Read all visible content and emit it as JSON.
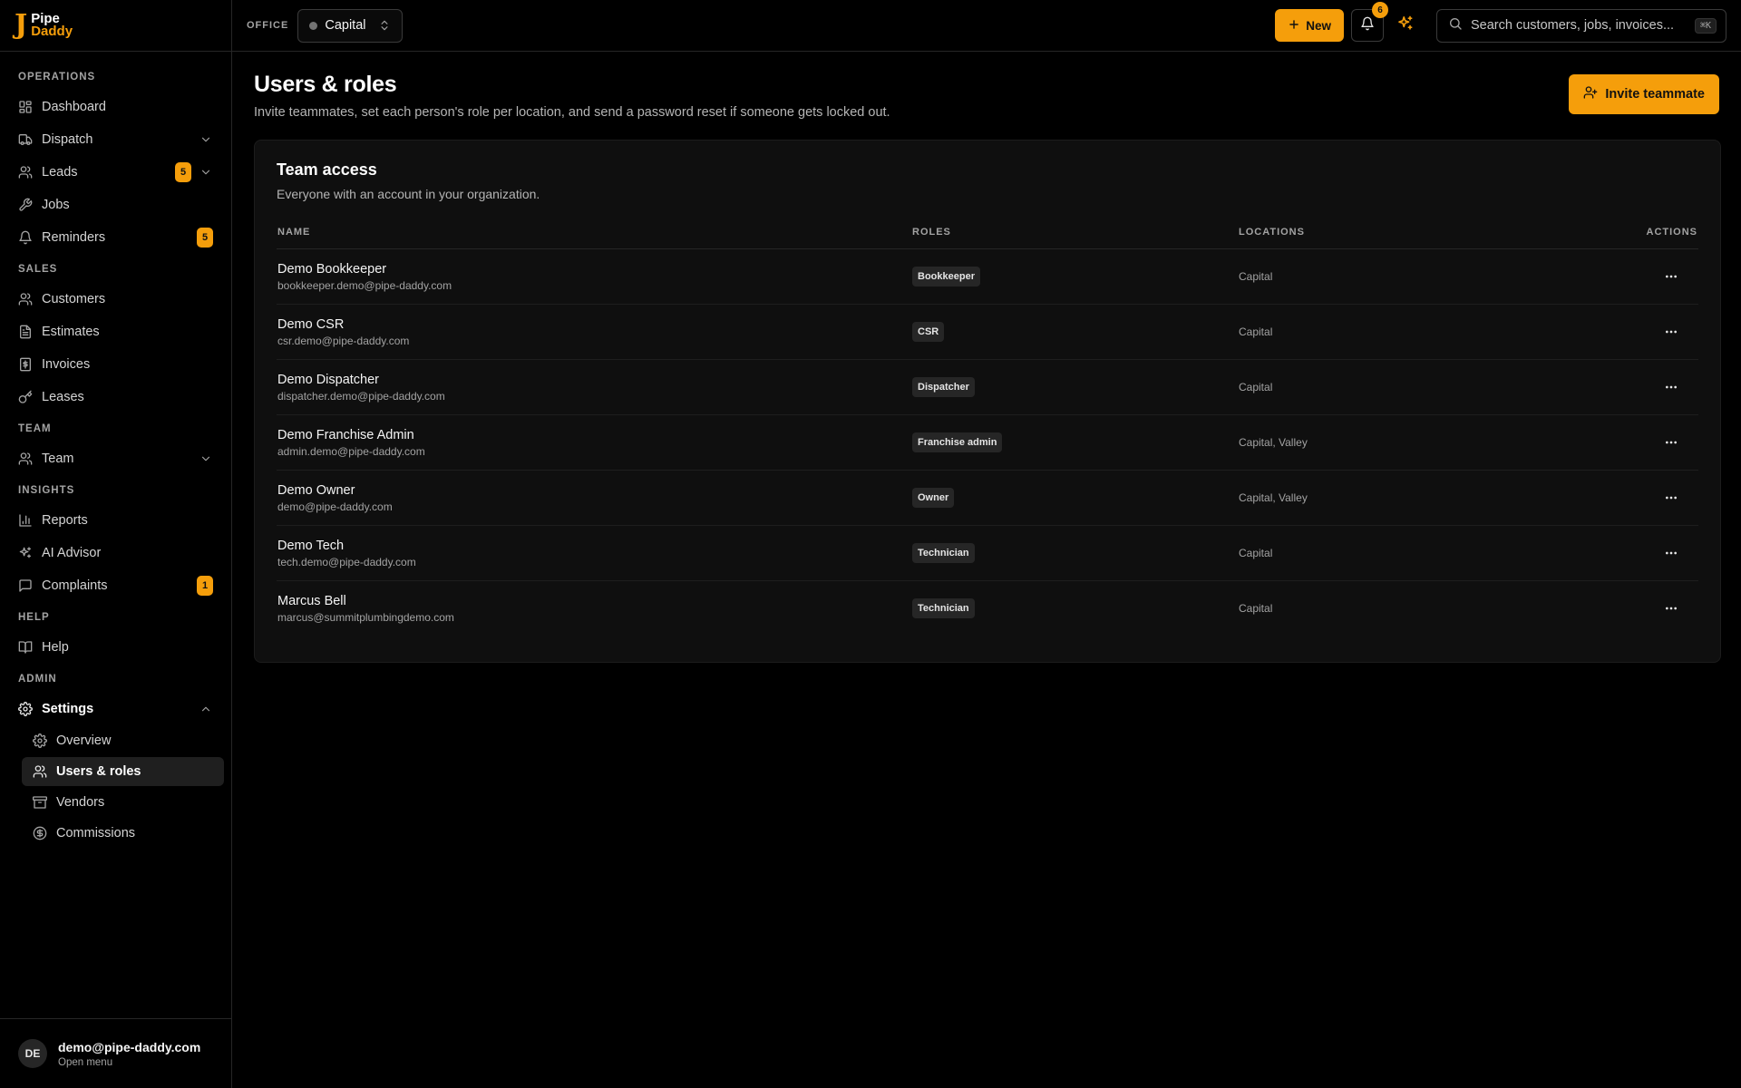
{
  "brand": {
    "mark": "J",
    "line1": "Pipe",
    "line2": "Daddy"
  },
  "sidebar": {
    "sections": [
      {
        "label": "OPERATIONS",
        "items": [
          {
            "label": "Dashboard",
            "icon": "dashboard-icon"
          },
          {
            "label": "Dispatch",
            "icon": "truck-icon",
            "chevron": "down"
          },
          {
            "label": "Leads",
            "icon": "users-icon",
            "badge": "5",
            "chevron": "down"
          },
          {
            "label": "Jobs",
            "icon": "wrench-icon"
          },
          {
            "label": "Reminders",
            "icon": "bell-icon",
            "badge": "5"
          }
        ]
      },
      {
        "label": "SALES",
        "items": [
          {
            "label": "Customers",
            "icon": "users-icon"
          },
          {
            "label": "Estimates",
            "icon": "document-icon"
          },
          {
            "label": "Invoices",
            "icon": "receipt-icon"
          },
          {
            "label": "Leases",
            "icon": "key-icon"
          }
        ]
      },
      {
        "label": "TEAM",
        "items": [
          {
            "label": "Team",
            "icon": "users-icon",
            "chevron": "down"
          }
        ]
      },
      {
        "label": "INSIGHTS",
        "items": [
          {
            "label": "Reports",
            "icon": "bar-chart-icon"
          },
          {
            "label": "AI Advisor",
            "icon": "sparkles-icon"
          },
          {
            "label": "Complaints",
            "icon": "message-icon",
            "badge": "1"
          }
        ]
      },
      {
        "label": "HELP",
        "items": [
          {
            "label": "Help",
            "icon": "book-icon"
          }
        ]
      }
    ],
    "admin": {
      "label": "ADMIN",
      "settings_label": "Settings",
      "sub_items": [
        {
          "label": "Overview",
          "icon": "gear-icon"
        },
        {
          "label": "Users & roles",
          "icon": "users-icon",
          "active": true
        },
        {
          "label": "Vendors",
          "icon": "package-icon"
        },
        {
          "label": "Commissions",
          "icon": "dollar-circle-icon"
        }
      ]
    },
    "user": {
      "initials": "DE",
      "email": "demo@pipe-daddy.com",
      "sub": "Open menu"
    }
  },
  "topbar": {
    "office_label": "OFFICE",
    "office_value": "Capital",
    "new_label": "New",
    "notification_count": "6",
    "search_placeholder": "Search customers, jobs, invoices...",
    "search_shortcut": "⌘K"
  },
  "page": {
    "title": "Users & roles",
    "subtitle": "Invite teammates, set each person's role per location, and send a password reset if someone gets locked out.",
    "invite_label": "Invite teammate"
  },
  "card": {
    "title": "Team access",
    "subtitle": "Everyone with an account in your organization.",
    "columns": [
      "NAME",
      "ROLES",
      "LOCATIONS",
      "ACTIONS"
    ],
    "rows": [
      {
        "name": "Demo Bookkeeper",
        "email": "bookkeeper.demo@pipe-daddy.com",
        "role": "Bookkeeper",
        "locations": "Capital"
      },
      {
        "name": "Demo CSR",
        "email": "csr.demo@pipe-daddy.com",
        "role": "CSR",
        "locations": "Capital"
      },
      {
        "name": "Demo Dispatcher",
        "email": "dispatcher.demo@pipe-daddy.com",
        "role": "Dispatcher",
        "locations": "Capital"
      },
      {
        "name": "Demo Franchise Admin",
        "email": "admin.demo@pipe-daddy.com",
        "role": "Franchise admin",
        "locations": "Capital, Valley"
      },
      {
        "name": "Demo Owner",
        "email": "demo@pipe-daddy.com",
        "role": "Owner",
        "locations": "Capital, Valley"
      },
      {
        "name": "Demo Tech",
        "email": "tech.demo@pipe-daddy.com",
        "role": "Technician",
        "locations": "Capital"
      },
      {
        "name": "Marcus Bell",
        "email": "marcus@summitplumbingdemo.com",
        "role": "Technician",
        "locations": "Capital"
      }
    ]
  },
  "colors": {
    "accent": "#f59e0b",
    "background": "#000000",
    "card": "#0f0f0f"
  }
}
